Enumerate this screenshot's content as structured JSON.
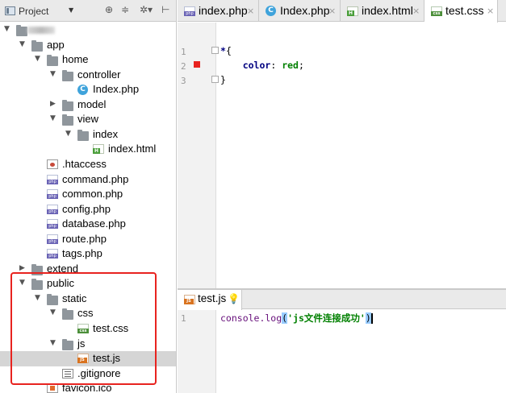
{
  "project_panel": {
    "title": "Project",
    "tree": [
      {
        "label": "",
        "depth": 0,
        "expanded": true,
        "type": "folder",
        "blurred": true
      },
      {
        "label": "app",
        "depth": 1,
        "expanded": true,
        "type": "folder"
      },
      {
        "label": "home",
        "depth": 2,
        "expanded": true,
        "type": "folder"
      },
      {
        "label": "controller",
        "depth": 3,
        "expanded": true,
        "type": "folder"
      },
      {
        "label": "Index.php",
        "depth": 4,
        "type": "class-file",
        "glyph": "C"
      },
      {
        "label": "model",
        "depth": 3,
        "type": "folder"
      },
      {
        "label": "view",
        "depth": 3,
        "expanded": true,
        "type": "folder"
      },
      {
        "label": "index",
        "depth": 4,
        "expanded": true,
        "type": "folder"
      },
      {
        "label": "index.html",
        "depth": 5,
        "type": "html-file"
      },
      {
        "label": ".htaccess",
        "depth": 2,
        "type": "htaccess-file"
      },
      {
        "label": "command.php",
        "depth": 2,
        "type": "php-file"
      },
      {
        "label": "common.php",
        "depth": 2,
        "type": "php-file"
      },
      {
        "label": "config.php",
        "depth": 2,
        "type": "php-file"
      },
      {
        "label": "database.php",
        "depth": 2,
        "type": "php-file"
      },
      {
        "label": "route.php",
        "depth": 2,
        "type": "php-file"
      },
      {
        "label": "tags.php",
        "depth": 2,
        "type": "php-file"
      },
      {
        "label": "extend",
        "depth": 1,
        "expanded": false,
        "type": "folder"
      },
      {
        "label": "public",
        "depth": 1,
        "expanded": true,
        "type": "folder"
      },
      {
        "label": "static",
        "depth": 2,
        "expanded": true,
        "type": "folder"
      },
      {
        "label": "css",
        "depth": 3,
        "expanded": true,
        "type": "folder"
      },
      {
        "label": "test.css",
        "depth": 4,
        "type": "css-file"
      },
      {
        "label": "js",
        "depth": 3,
        "expanded": true,
        "type": "folder"
      },
      {
        "label": "test.js",
        "depth": 4,
        "type": "js-file",
        "selected": true
      },
      {
        "label": ".gitignore",
        "depth": 3,
        "type": "text-file"
      },
      {
        "label": "favicon.ico",
        "depth": 2,
        "type": "ico-file"
      }
    ]
  },
  "tabs": [
    {
      "label": "index.php",
      "icon": "php-file-icon",
      "active": false
    },
    {
      "label": "Index.php",
      "icon": "class-file-icon",
      "active": false
    },
    {
      "label": "index.html",
      "icon": "html-file-icon",
      "active": false
    },
    {
      "label": "test.css",
      "icon": "css-file-icon",
      "active": true
    }
  ],
  "css_editor": {
    "lines": [
      {
        "no": "1",
        "parts": [
          {
            "cls": "kw",
            "t": "*"
          },
          {
            "cls": "",
            "t": "{"
          }
        ]
      },
      {
        "no": "2",
        "parts": [
          {
            "cls": "",
            "t": "    "
          },
          {
            "cls": "kw",
            "t": "color"
          },
          {
            "cls": "",
            "t": ": "
          },
          {
            "cls": "str-val",
            "t": "red"
          },
          {
            "cls": "",
            "t": ";"
          }
        ]
      },
      {
        "no": "3",
        "parts": [
          {
            "cls": "",
            "t": "}"
          }
        ]
      }
    ],
    "color_swatch": "#e8231f"
  },
  "js_editor": {
    "tab_label": "test.js",
    "lines": [
      {
        "no": "1",
        "code_fn": "console.log",
        "code_open": "(",
        "code_str": "'js文件连接成功'",
        "code_close": ")"
      }
    ]
  },
  "colors": {
    "highlight": "#e8231f",
    "accent_selected_row": "#d5d5d5"
  }
}
